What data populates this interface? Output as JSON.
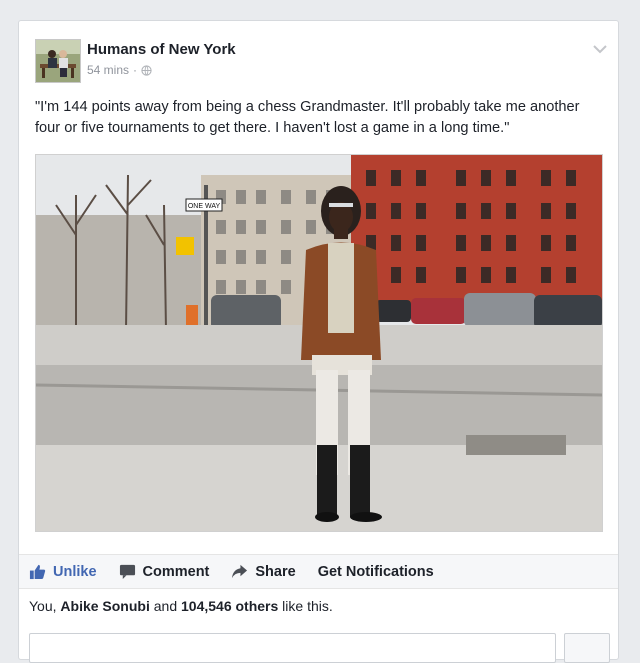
{
  "post": {
    "page_name": "Humans of New York",
    "time": "54 mins",
    "separator": "·",
    "privacy_icon": "globe-icon",
    "text": "\"I'm 144 points away from being a chess Grandmaster. It'll probably take me another four or five tournaments to get there. I haven't lost a game in a long time.\""
  },
  "photo": {
    "street_sign": "ONE WAY"
  },
  "actions": [
    {
      "label": "Unlike",
      "icon": "thumbs-up-icon",
      "liked": true
    },
    {
      "label": "Comment",
      "icon": "comment-icon"
    },
    {
      "label": "Share",
      "icon": "share-icon"
    },
    {
      "label": "Get Notifications",
      "icon": ""
    }
  ],
  "likes": {
    "prefix": "You, ",
    "friend": "Abike Sonubi",
    "middle": " and ",
    "others": "104,546 others",
    "suffix": " like this."
  },
  "colors": {
    "accent": "#4267b2",
    "text": "#1d2129",
    "muted": "#90949c",
    "background": "#e9ebee"
  }
}
